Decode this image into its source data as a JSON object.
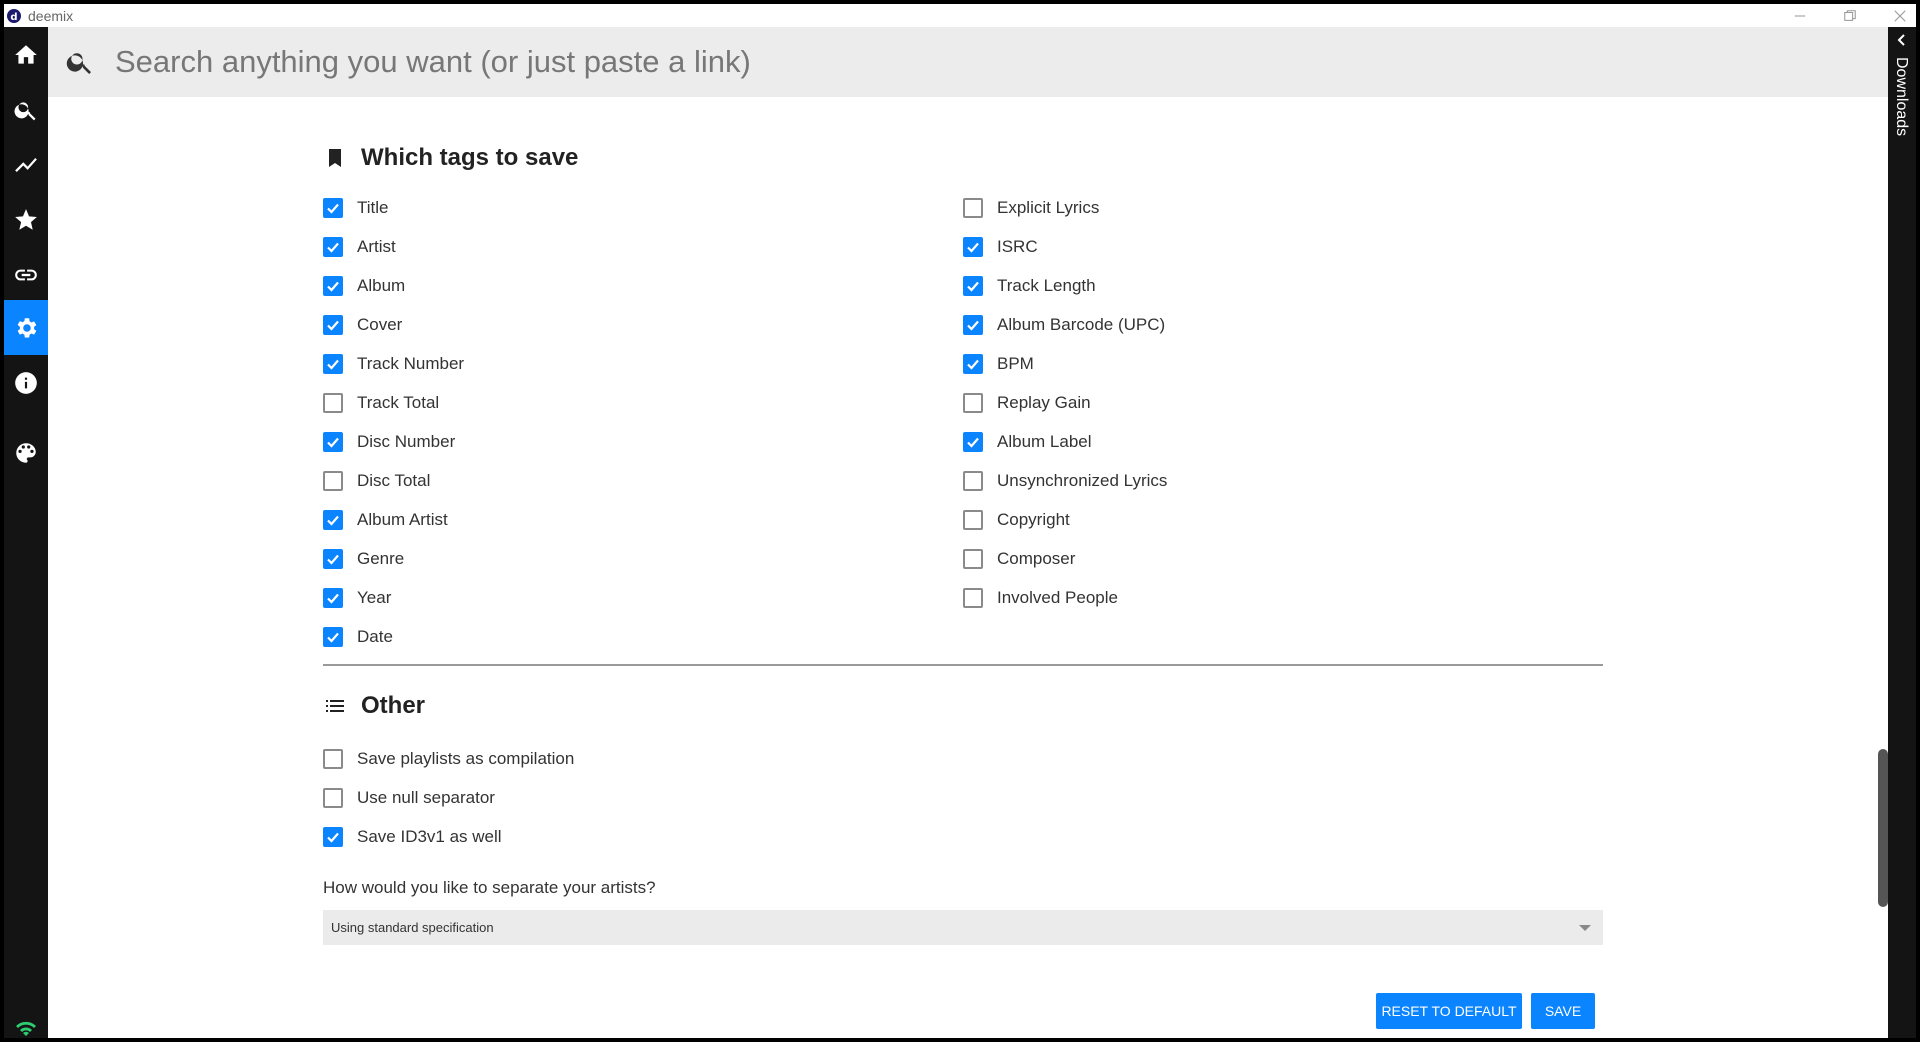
{
  "window": {
    "title": "deemix"
  },
  "search": {
    "placeholder": "Search anything you want (or just paste a link)"
  },
  "sidebar": {
    "items": [
      {
        "name": "home",
        "icon": "home-icon",
        "active": false
      },
      {
        "name": "search",
        "icon": "search-icon",
        "active": false
      },
      {
        "name": "charts",
        "icon": "trending-icon",
        "active": false
      },
      {
        "name": "favorites",
        "icon": "star-icon",
        "active": false
      },
      {
        "name": "link-analyzer",
        "icon": "link-icon",
        "active": false
      },
      {
        "name": "settings",
        "icon": "gear-icon",
        "active": true
      },
      {
        "name": "about",
        "icon": "info-icon",
        "active": false
      },
      {
        "name": "theme",
        "icon": "palette-icon",
        "active": false
      }
    ],
    "status_icon": "wifi-icon",
    "status_color": "#2ecc71"
  },
  "tags_section": {
    "title": "Which tags to save",
    "icon": "bookmark-icon",
    "left_column": [
      {
        "label": "Title",
        "checked": true
      },
      {
        "label": "Artist",
        "checked": true
      },
      {
        "label": "Album",
        "checked": true
      },
      {
        "label": "Cover",
        "checked": true
      },
      {
        "label": "Track Number",
        "checked": true
      },
      {
        "label": "Track Total",
        "checked": false
      },
      {
        "label": "Disc Number",
        "checked": true
      },
      {
        "label": "Disc Total",
        "checked": false
      },
      {
        "label": "Album Artist",
        "checked": true
      },
      {
        "label": "Genre",
        "checked": true
      },
      {
        "label": "Year",
        "checked": true
      },
      {
        "label": "Date",
        "checked": true
      }
    ],
    "right_column": [
      {
        "label": "Explicit Lyrics",
        "checked": false
      },
      {
        "label": "ISRC",
        "checked": true
      },
      {
        "label": "Track Length",
        "checked": true
      },
      {
        "label": "Album Barcode (UPC)",
        "checked": true
      },
      {
        "label": "BPM",
        "checked": true
      },
      {
        "label": "Replay Gain",
        "checked": false
      },
      {
        "label": "Album Label",
        "checked": true
      },
      {
        "label": "Unsynchronized Lyrics",
        "checked": false
      },
      {
        "label": "Copyright",
        "checked": false
      },
      {
        "label": "Composer",
        "checked": false
      },
      {
        "label": "Involved People",
        "checked": false
      }
    ]
  },
  "other_section": {
    "title": "Other",
    "icon": "list-icon",
    "options": [
      {
        "label": "Save playlists as compilation",
        "checked": false
      },
      {
        "label": "Use null separator",
        "checked": false
      },
      {
        "label": "Save ID3v1 as well",
        "checked": true
      }
    ],
    "separator_question": "How would you like to separate your artists?",
    "separator_selected": "Using standard specification"
  },
  "actions": {
    "reset_label": "Reset to Default",
    "save_label": "Save"
  },
  "downloads": {
    "label": "Downloads"
  },
  "colors": {
    "accent": "#0a84ff",
    "sidebar_bg": "#141414",
    "search_bg": "#ececec"
  }
}
